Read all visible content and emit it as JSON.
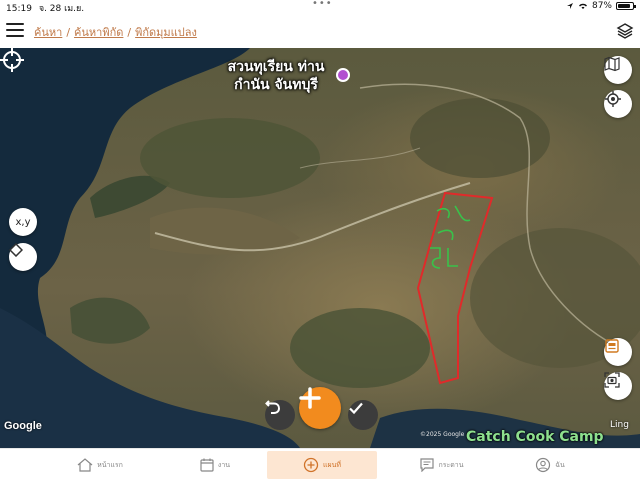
{
  "status_bar": {
    "time": "15:19",
    "date": "จ. 28 เม.ย.",
    "battery": "87%",
    "battery_level": 0.87
  },
  "header": {
    "breadcrumb": [
      "ค้นหา",
      "ค้นหาพิกัด",
      "พิกัดมุมแปลง"
    ],
    "separator": "/"
  },
  "map": {
    "place_label_line1": "สวนทุเรียน ท่าน",
    "place_label_line2": "กำนัน จันทบุรี",
    "coordinate_button_label": "x,y",
    "attribution_logo": "Google",
    "copyright": "©2025 Google",
    "poi_label": "Catch Cook Camp",
    "poi_label_partial": "Ling",
    "parcel_annotation": "56",
    "outline_color": "#e02a2a",
    "annotation_color": "#39c24a"
  },
  "bottom_nav": {
    "items": [
      {
        "label": "หน้าแรก",
        "icon": "home-icon"
      },
      {
        "label": "งาน",
        "icon": "calendar-icon"
      },
      {
        "label": "แผนที่",
        "icon": "plus-circle-icon",
        "active": true
      },
      {
        "label": "กระดาน",
        "icon": "message-icon"
      },
      {
        "label": "ฉัน",
        "icon": "user-icon"
      }
    ]
  },
  "colors": {
    "accent": "#f28b1e",
    "breadcrumb": "#c07a4a",
    "active_tab_bg": "#fde6d2"
  }
}
